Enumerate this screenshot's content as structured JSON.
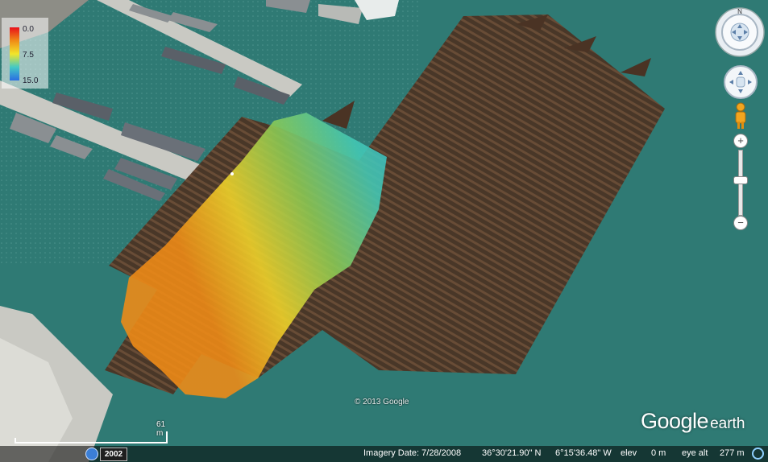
{
  "legend": {
    "min": "0.0",
    "mid": "7.5",
    "max": "15.0",
    "colors": [
      "#e8101a",
      "#f08b16",
      "#f2e52a",
      "#44c9c5",
      "#2a6de3"
    ]
  },
  "copyright": "© 2013 Google",
  "scale": {
    "label": "61 m"
  },
  "brand": {
    "word1": "Google",
    "word2": "earth"
  },
  "status": {
    "year": "2002",
    "imagery_date": "Imagery Date: 7/28/2008",
    "lat": "36°30'21.90\" N",
    "lon": "6°15'36.48\" W",
    "elev_label": "elev",
    "elev_value": "0 m",
    "eye_alt_label": "eye alt",
    "eye_alt_value": "277 m"
  },
  "colors": {
    "water": "#2f7a74",
    "sonar": "#4a3324",
    "dock": "#c9c9c3"
  },
  "icons": {
    "nav": "navigation-compass-icon",
    "look": "look-around-icon",
    "pegman": "street-view-pegman-icon"
  }
}
